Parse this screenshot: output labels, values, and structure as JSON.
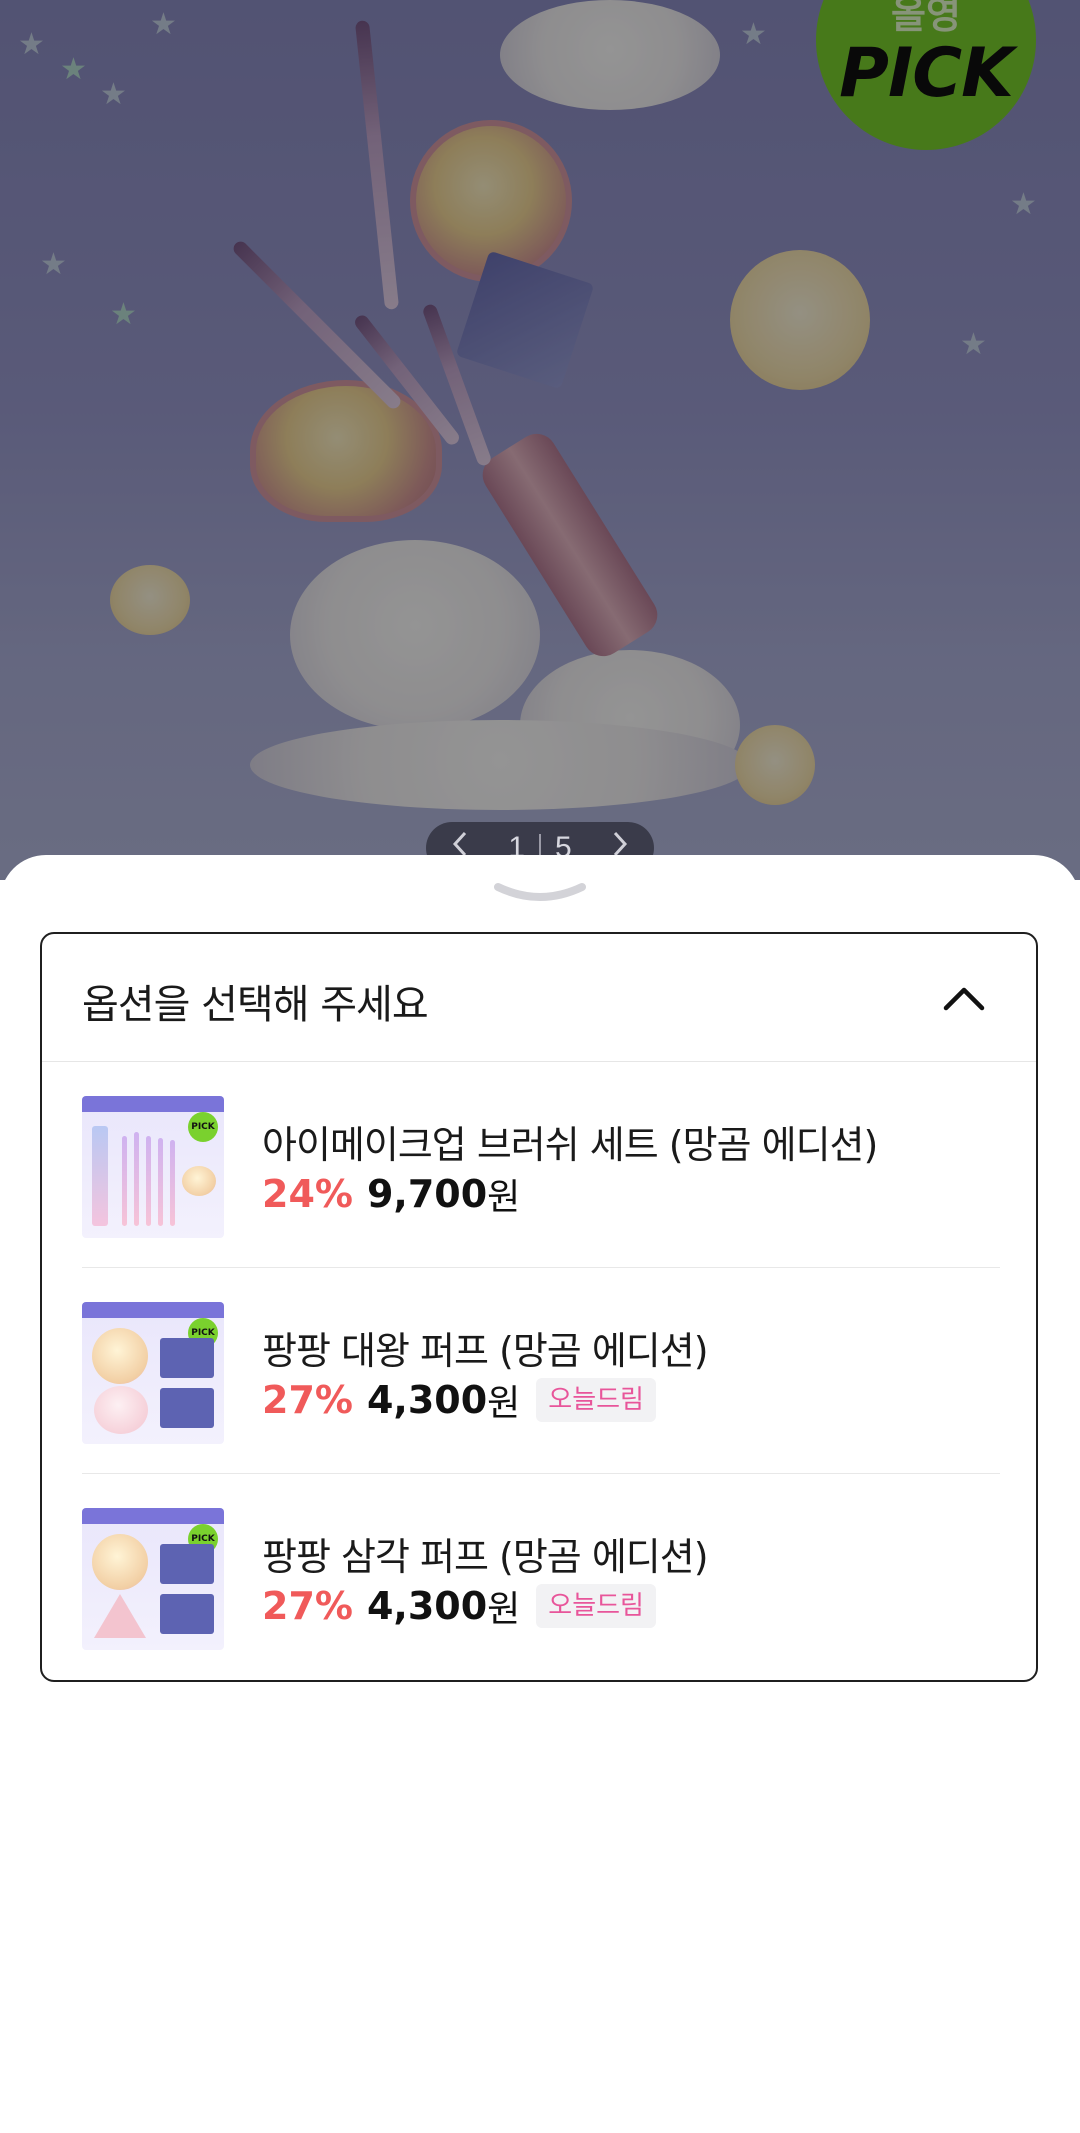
{
  "hero": {
    "badge_top": "올영",
    "badge_text": "PICK",
    "pager": {
      "current": "1",
      "total": "5"
    }
  },
  "sheet": {
    "option_title": "옵션을 선택해 주세요",
    "items": [
      {
        "name": "아이메이크업 브러쉬 세트 (망곰 에디션)",
        "discount": "24%",
        "price": "9,700",
        "unit": "원",
        "badge": ""
      },
      {
        "name": "팡팡 대왕 퍼프 (망곰 에디션)",
        "discount": "27%",
        "price": "4,300",
        "unit": "원",
        "badge": "오늘드림"
      },
      {
        "name": "팡팡 삼각 퍼프 (망곰 에디션)",
        "discount": "27%",
        "price": "4,300",
        "unit": "원",
        "badge": "오늘드림"
      }
    ]
  },
  "colors": {
    "discount": "#f05a5a",
    "badge_text": "#e8559a",
    "badge_bg": "#f2f2f4",
    "pick_badge": "#7ad12e"
  },
  "icons": {
    "collapse": "chevron-up-icon",
    "sheet_handle": "chevron-down-icon",
    "prev": "chevron-left-icon",
    "next": "chevron-right-icon"
  }
}
